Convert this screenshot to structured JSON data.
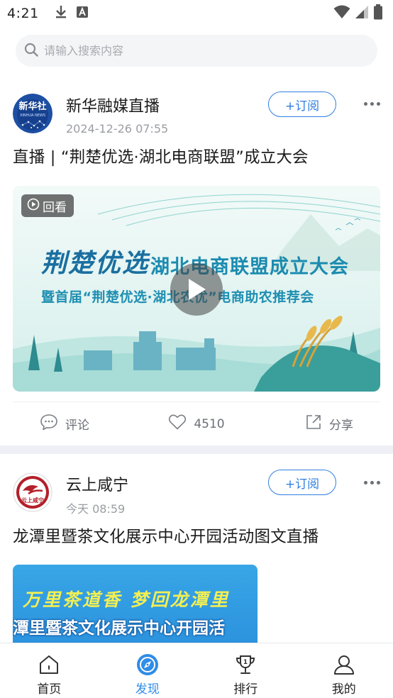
{
  "status_bar": {
    "time": "4:21"
  },
  "search": {
    "placeholder": "请输入搜索内容"
  },
  "feed": [
    {
      "author": "新华融媒直播",
      "time": "2024-12-26 07:55",
      "subscribe_label": "+订阅",
      "title": "直播 | “荆楚优选·湖北电商联盟”成立大会",
      "video": {
        "badge": "回看",
        "calligraphy": "荆楚优选",
        "main_title": "湖北电商联盟成立大会",
        "sub_title": "暨首届“荆楚优选·湖北农优”电商助农推荐会"
      },
      "actions": {
        "comment": "评论",
        "likes": "4510",
        "share": "分享"
      }
    },
    {
      "author": "云上咸宁",
      "time": "今天 08:59",
      "subscribe_label": "+订阅",
      "title": "龙潭里暨茶文化展示中心开园活动图文直播",
      "image": {
        "line1": "万里茶道香  梦回龙潭里",
        "line2": "潭里暨茶文化展示中心开园活"
      }
    }
  ],
  "bottom_nav": [
    {
      "label": "首页",
      "icon": "home-icon"
    },
    {
      "label": "发现",
      "icon": "discover-icon",
      "active": true
    },
    {
      "label": "排行",
      "icon": "trophy-icon"
    },
    {
      "label": "我的",
      "icon": "user-icon"
    }
  ],
  "colors": {
    "accent": "#2f7ee0",
    "nav_active": "#2f8ce8",
    "divider": "#eef0f5"
  }
}
